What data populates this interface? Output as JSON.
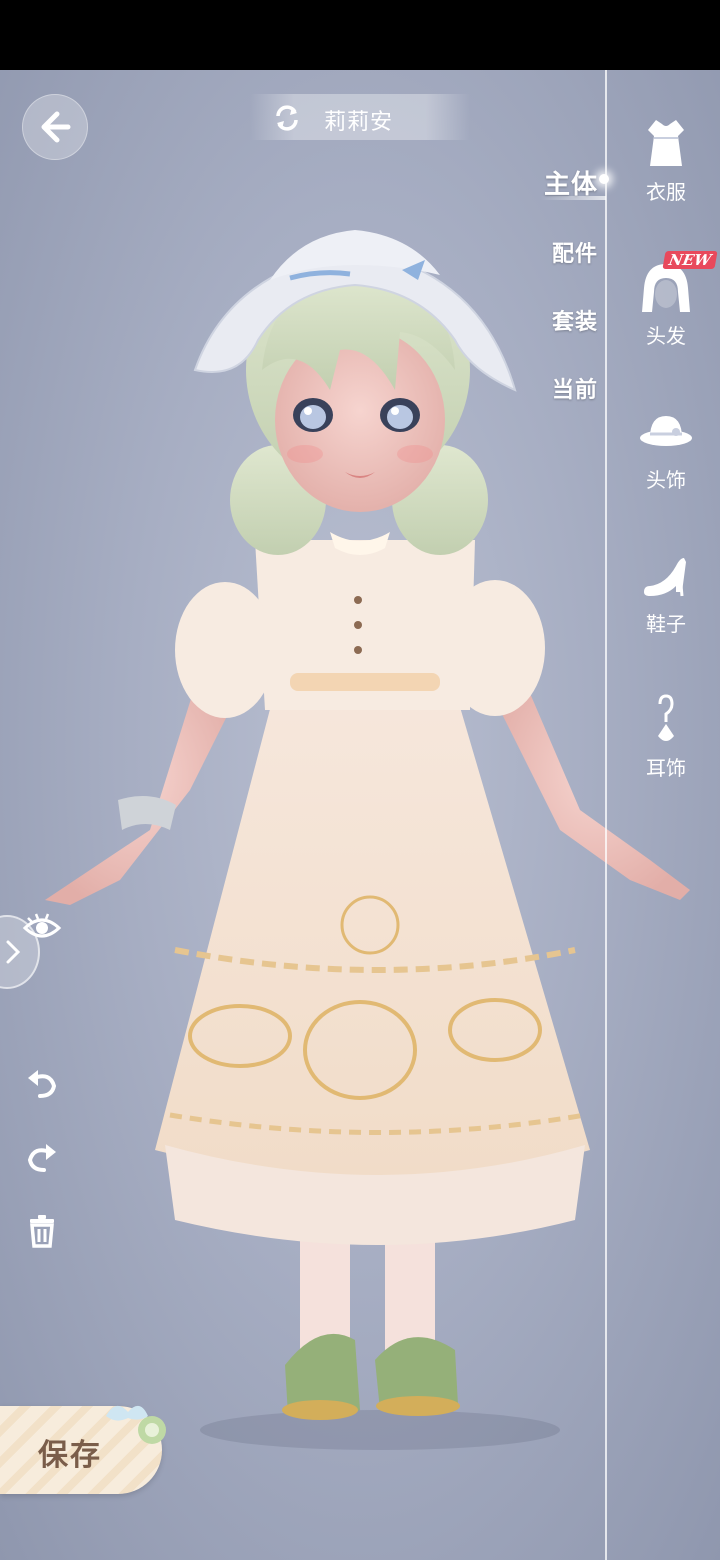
{
  "header": {
    "character_name": "莉莉安"
  },
  "categories": [
    {
      "label": "主体",
      "active": true
    },
    {
      "label": "配件",
      "active": false
    },
    {
      "label": "套装",
      "active": false
    },
    {
      "label": "当前",
      "active": false
    }
  ],
  "tabs": [
    {
      "label": "衣服",
      "icon": "dress-icon"
    },
    {
      "label": "头发",
      "icon": "hair-icon",
      "badge": "NEW"
    },
    {
      "label": "头饰",
      "icon": "hat-icon"
    },
    {
      "label": "鞋子",
      "icon": "shoe-icon"
    },
    {
      "label": "耳饰",
      "icon": "earring-icon"
    }
  ],
  "actions": {
    "save_label": "保存"
  },
  "colors": {
    "background": "#a7aec3",
    "badge": "#e8495c",
    "accent_text": "#ffffff"
  }
}
